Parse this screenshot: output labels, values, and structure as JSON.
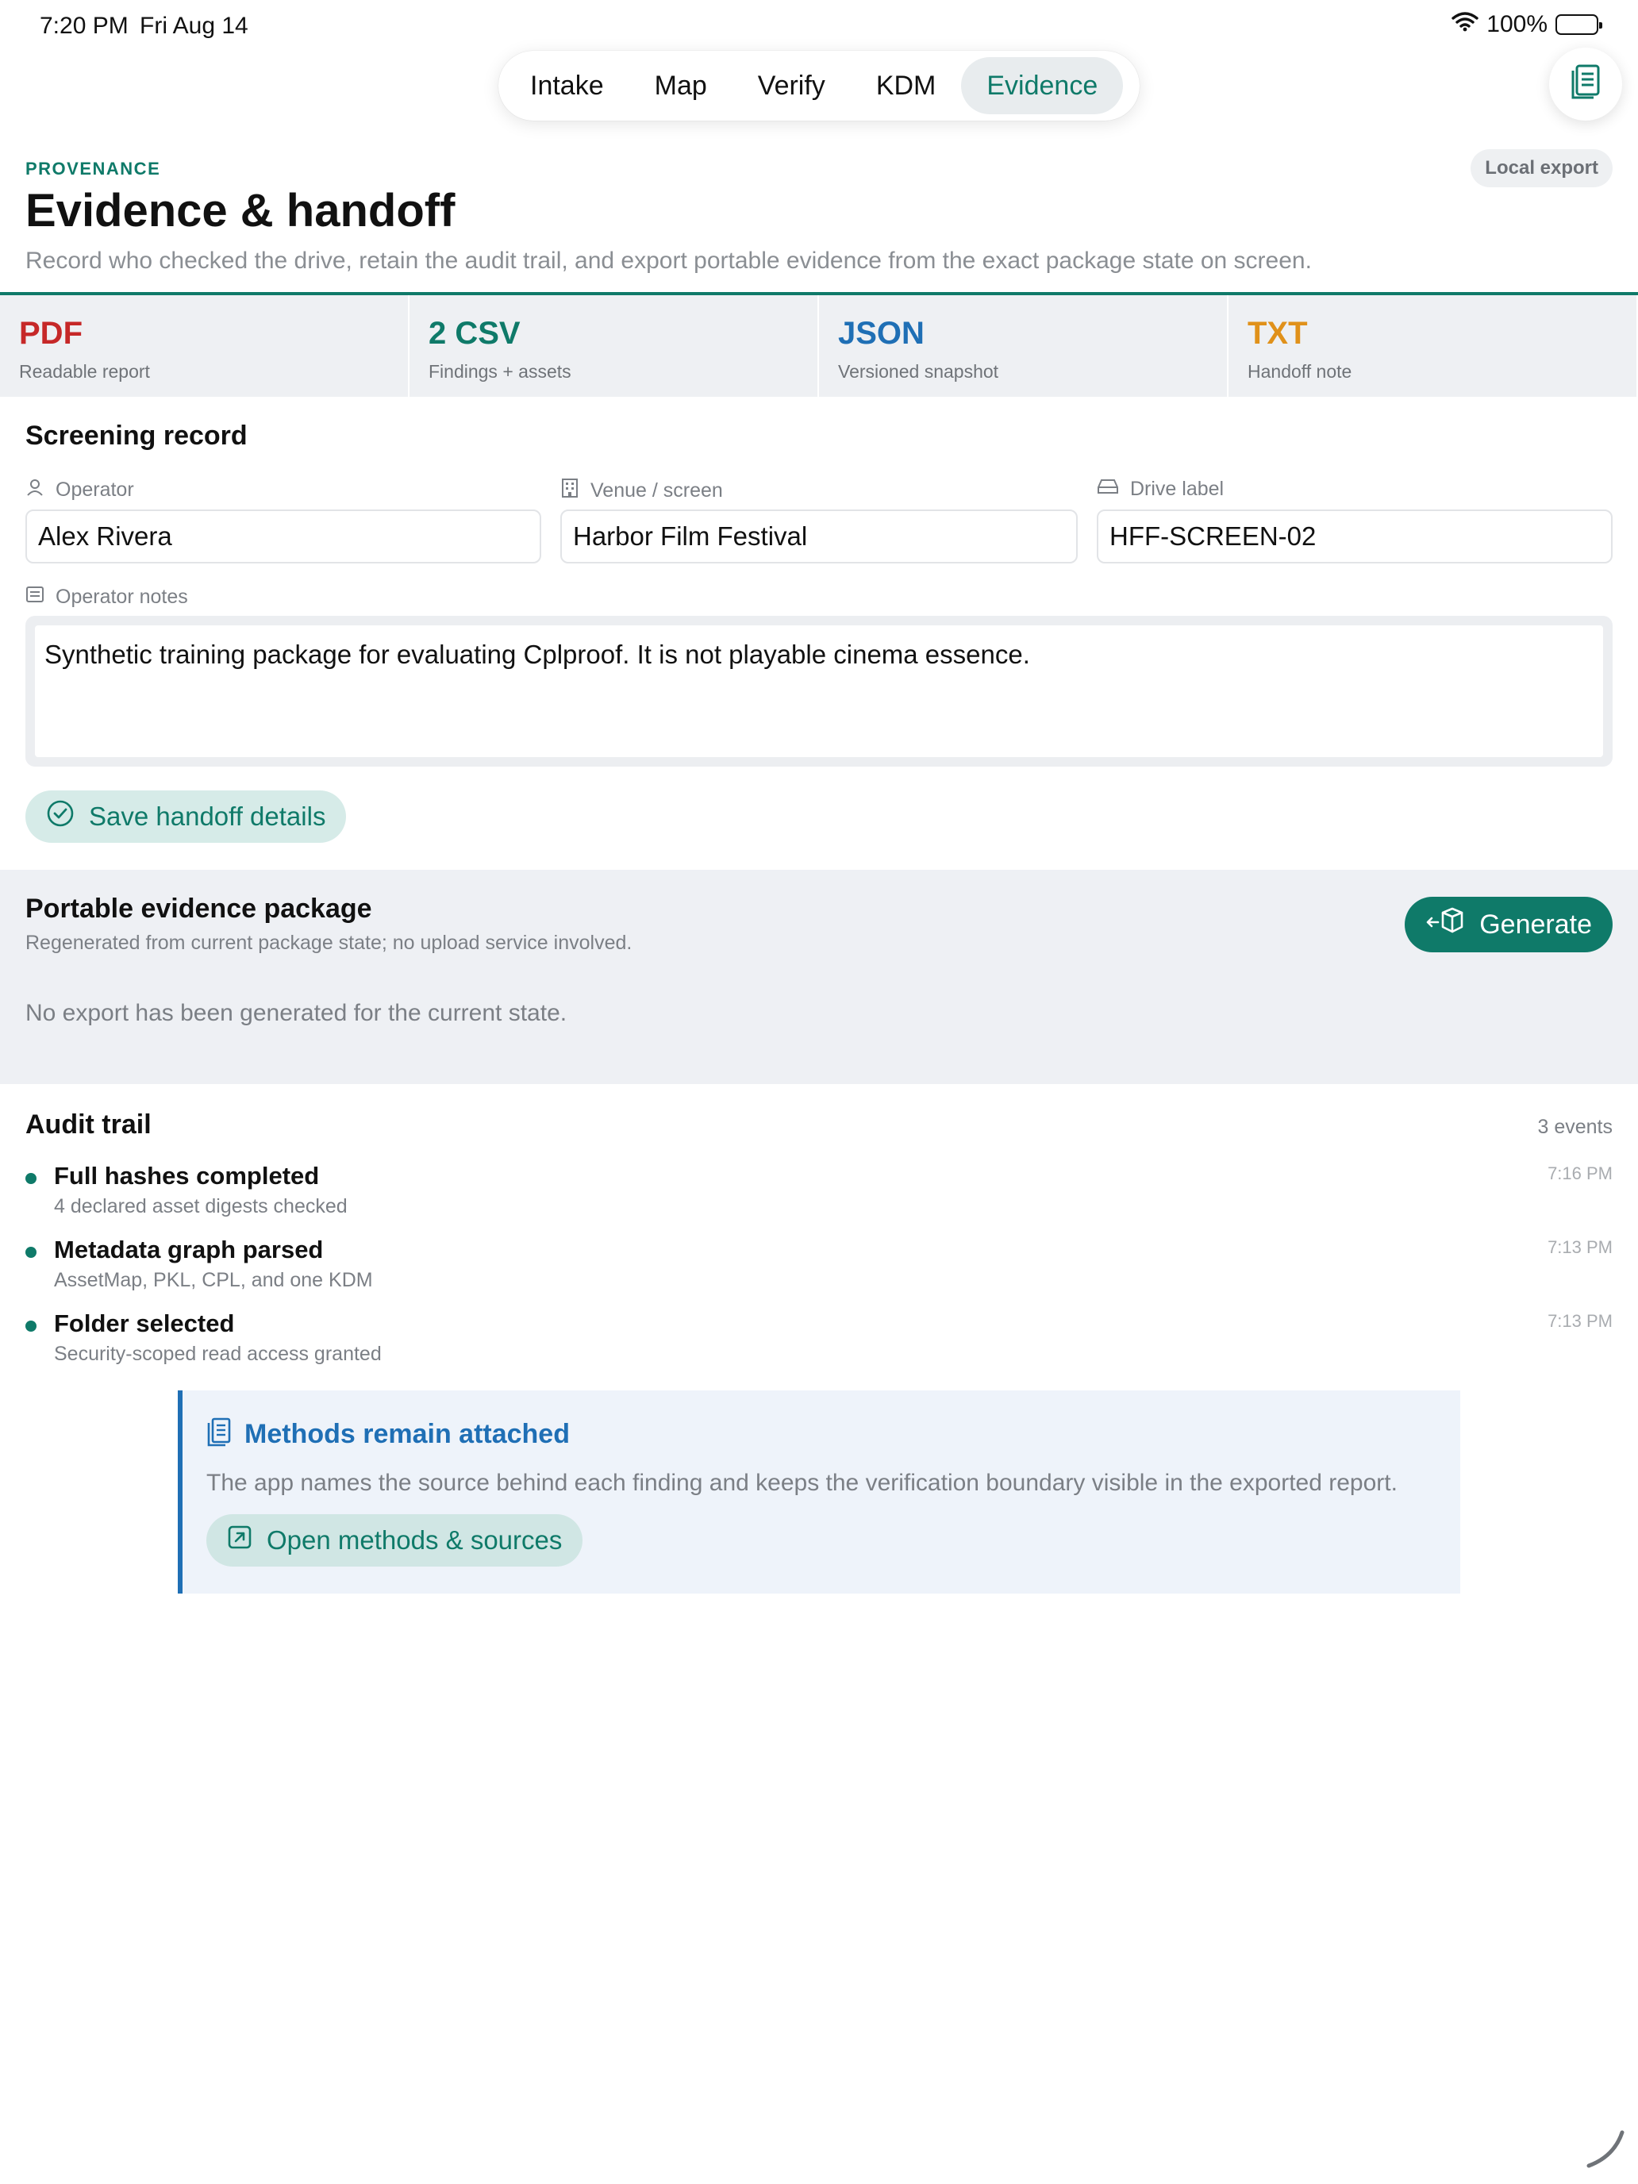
{
  "status_bar": {
    "time": "7:20 PM",
    "date": "Fri Aug 14",
    "battery": "100%"
  },
  "tabs": [
    {
      "label": "Intake",
      "active": false
    },
    {
      "label": "Map",
      "active": false
    },
    {
      "label": "Verify",
      "active": false
    },
    {
      "label": "KDM",
      "active": false
    },
    {
      "label": "Evidence",
      "active": true
    }
  ],
  "header": {
    "eyebrow": "PROVENANCE",
    "title": "Evidence & handoff",
    "subtitle": "Record who checked the drive, retain the audit trail, and export portable evidence from the exact package state on screen.",
    "badge": "Local export"
  },
  "formats": [
    {
      "title": "PDF",
      "subtitle": "Readable report",
      "color": "#c62828"
    },
    {
      "title": "2 CSV",
      "subtitle": "Findings + assets",
      "color": "#0f7a69"
    },
    {
      "title": "JSON",
      "subtitle": "Versioned snapshot",
      "color": "#1f6fb5"
    },
    {
      "title": "TXT",
      "subtitle": "Handoff note",
      "color": "#e0911a"
    }
  ],
  "screening": {
    "heading": "Screening record",
    "operator_label": "Operator",
    "operator_value": "Alex Rivera",
    "venue_label": "Venue / screen",
    "venue_value": "Harbor Film Festival",
    "drive_label": "Drive label",
    "drive_value": "HFF-SCREEN-02",
    "notes_label": "Operator notes",
    "notes_value": "Synthetic training package for evaluating Cplproof. It is not playable cinema essence.",
    "save_label": "Save handoff details"
  },
  "package": {
    "title": "Portable evidence package",
    "subtitle": "Regenerated from current package state; no upload service involved.",
    "empty": "No export has been generated for the current state.",
    "generate_label": "Generate"
  },
  "audit": {
    "heading": "Audit trail",
    "count": "3 events",
    "events": [
      {
        "title": "Full hashes completed",
        "subtitle": "4 declared asset digests checked",
        "time": "7:16 PM"
      },
      {
        "title": "Metadata graph parsed",
        "subtitle": "AssetMap, PKL, CPL, and one KDM",
        "time": "7:13 PM"
      },
      {
        "title": "Folder selected",
        "subtitle": "Security-scoped read access granted",
        "time": "7:13 PM"
      }
    ]
  },
  "methods": {
    "title": "Methods remain attached",
    "body": "The app names the source behind each finding and keeps the verification boundary visible in the exported report.",
    "button_label": "Open methods & sources"
  },
  "colors": {
    "accent": "#0f7a69",
    "info": "#1f6fb5"
  }
}
